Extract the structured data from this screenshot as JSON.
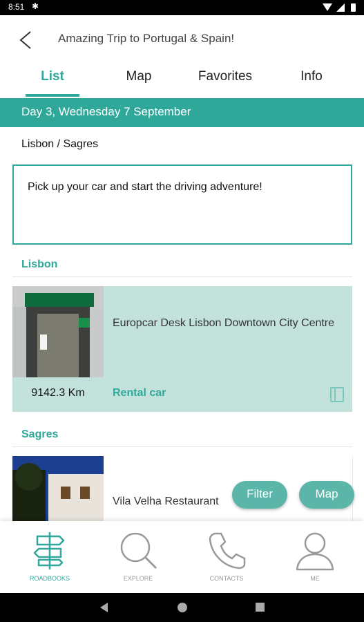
{
  "status_bar": {
    "time": "8:51"
  },
  "header": {
    "title": "Amazing Trip to Portugal & Spain!"
  },
  "tabs": [
    {
      "label": "List",
      "active": true
    },
    {
      "label": "Map",
      "active": false
    },
    {
      "label": "Favorites",
      "active": false
    },
    {
      "label": "Info",
      "active": false
    }
  ],
  "day_banner": "Day 3, Wednesday  7 September",
  "route": "Lisbon / Sagres",
  "note": "Pick up your car and start the driving adventure!",
  "sections": [
    {
      "name": "Lisbon",
      "item": {
        "name": "Europcar Desk Lisbon Downtown City Centre",
        "distance": "9142.3 Km",
        "category": "Rental car"
      }
    },
    {
      "name": "Sagres",
      "item": {
        "name": "Vila Velha Restaurant"
      }
    }
  ],
  "fabs": {
    "filter": "Filter",
    "map": "Map"
  },
  "bottom_nav": [
    {
      "label": "ROADBOOKS",
      "icon": "signpost-icon",
      "active": true
    },
    {
      "label": "EXPLORE",
      "icon": "search-icon",
      "active": false
    },
    {
      "label": "CONTACTS",
      "icon": "phone-icon",
      "active": false
    },
    {
      "label": "ME",
      "icon": "user-icon",
      "active": false
    }
  ],
  "colors": {
    "accent": "#2fa89a",
    "card_bg": "#c3e2dc",
    "fab": "#5bb5a8"
  }
}
